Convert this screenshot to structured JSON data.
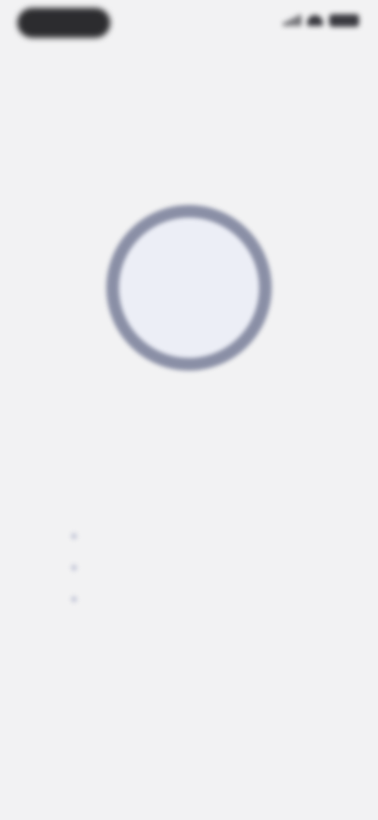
{
  "status_bar": {
    "time": "",
    "icons": [
      "signal-icon",
      "wifi-icon",
      "battery-icon"
    ]
  },
  "progress": {
    "fraction": 1.0,
    "label": "",
    "ring_color": "#8a8fa6",
    "track_color": "#e9eaf2"
  },
  "heading": "",
  "steps": [
    {
      "text": ""
    },
    {
      "text": ""
    },
    {
      "text": ""
    }
  ],
  "colors": {
    "background": "#f2f2f3",
    "accent": "#8a8fa6",
    "list_text": "#aeb3cc"
  }
}
